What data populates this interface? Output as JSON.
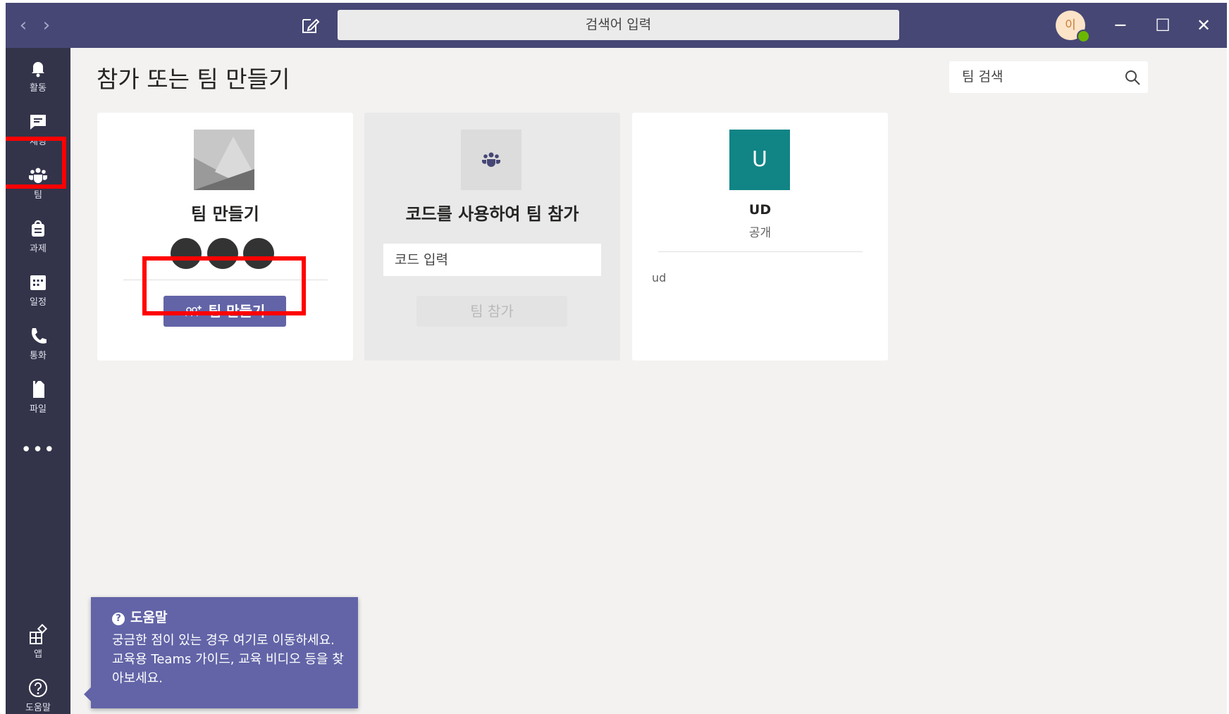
{
  "titlebar": {
    "back_glyph": "‹",
    "forward_glyph": "›",
    "search_placeholder": "검색어 입력",
    "avatar_initial": "이",
    "minimize_glyph": "─",
    "maximize_glyph": "☐",
    "close_glyph": "✕"
  },
  "rail": {
    "items": [
      {
        "label": "활동",
        "icon": "bell-icon"
      },
      {
        "label": "채팅",
        "icon": "chat-icon"
      },
      {
        "label": "팀",
        "icon": "teams-icon"
      },
      {
        "label": "과제",
        "icon": "assignments-icon"
      },
      {
        "label": "일정",
        "icon": "calendar-icon"
      },
      {
        "label": "통화",
        "icon": "phone-icon"
      },
      {
        "label": "파일",
        "icon": "file-icon"
      }
    ],
    "more": "•••",
    "bottom": [
      {
        "label": "앱",
        "icon": "apps-icon"
      },
      {
        "label": "도움말",
        "icon": "help-icon"
      }
    ]
  },
  "main": {
    "title": "참가 또는 팀 만들기",
    "team_search_placeholder": "팀 검색",
    "cards": {
      "create": {
        "title": "팀 만들기",
        "button": "팀 만들기"
      },
      "join": {
        "title": "코드를 사용하여 팀 참가",
        "code_placeholder": "코드 입력",
        "button": "팀 참가"
      },
      "team": {
        "initial": "U",
        "name": "UD",
        "visibility": "공개",
        "description": "ud"
      }
    }
  },
  "help": {
    "title": "도움말",
    "body": "궁금한 점이 있는 경우 여기로 이동하세요. 교육용 Teams 가이드, 교육 비디오 등을 찾아보세요."
  },
  "colors": {
    "titlebar": "#464775",
    "rail": "#33344a",
    "accent": "#6264a7",
    "team_tile": "#118485",
    "highlight": "#ff0000"
  }
}
